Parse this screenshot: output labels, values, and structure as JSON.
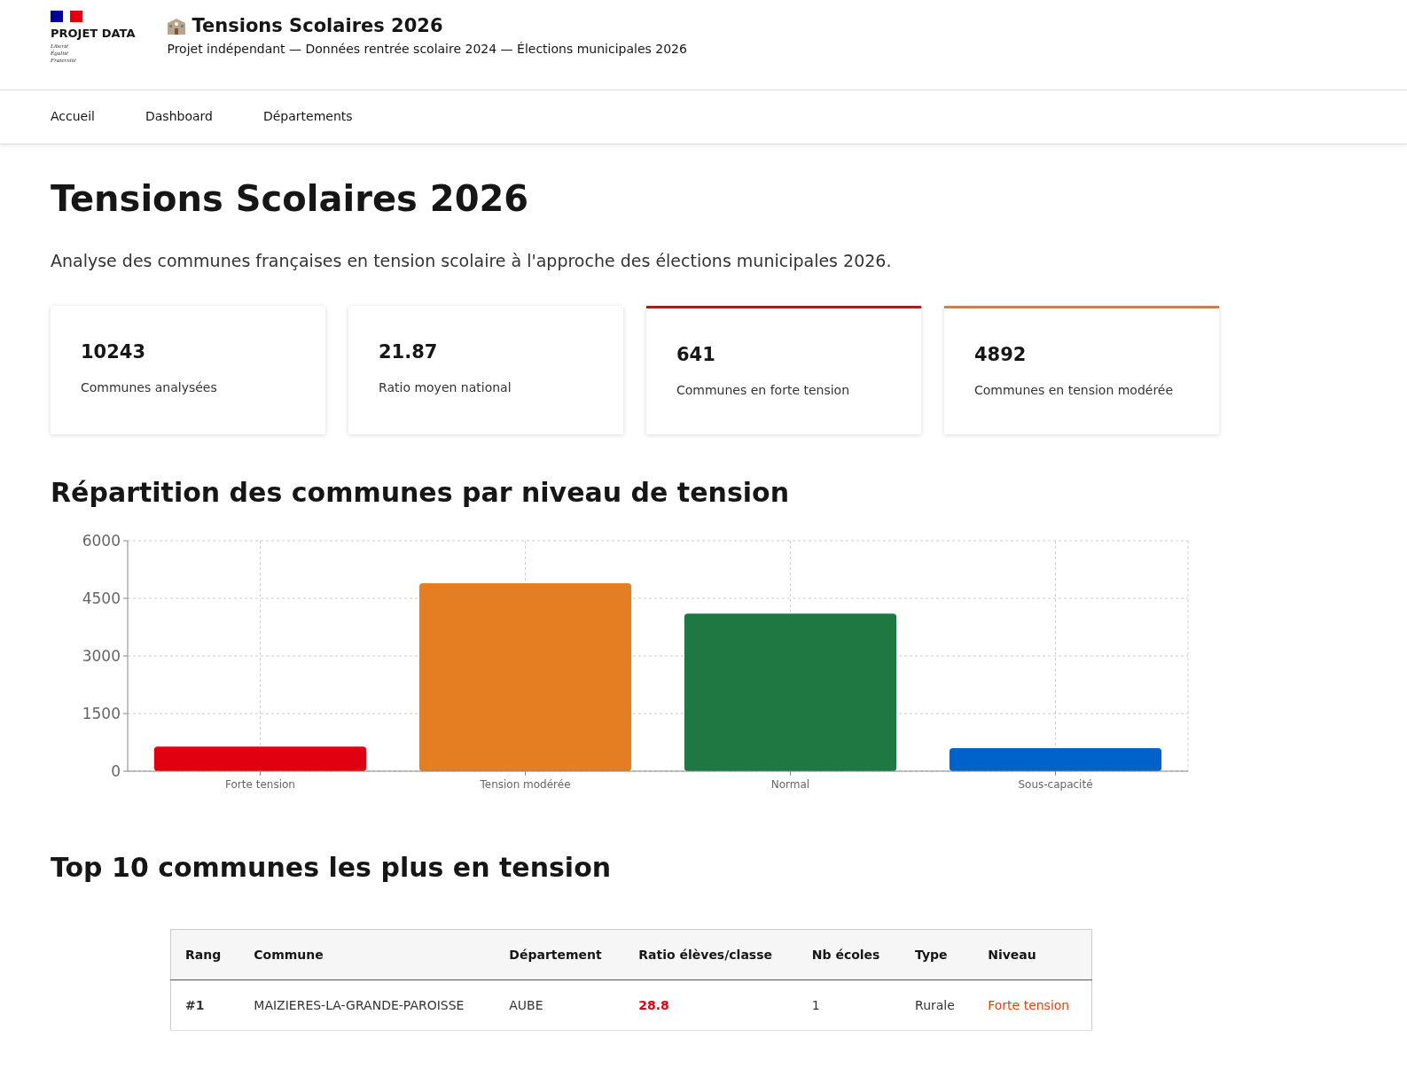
{
  "header": {
    "brand": "PROJET DATA",
    "motto": [
      "Liberté",
      "Égalité",
      "Fraternité"
    ],
    "title": "Tensions Scolaires 2026",
    "subtitle": "Projet indépendant — Données rentrée scolaire 2024 — Élections municipales 2026"
  },
  "nav": [
    {
      "label": "Accueil",
      "selected": false
    },
    {
      "label": "Dashboard",
      "selected": false
    },
    {
      "label": "Départements",
      "selected": false
    }
  ],
  "page_title": "Tensions Scolaires 2026",
  "intro": "Analyse des communes françaises en tension scolaire à l'approche des élections municipales 2026.",
  "stats": [
    {
      "value": "10243",
      "label": "Communes analysées"
    },
    {
      "value": "21.87",
      "label": "Ratio moyen national"
    },
    {
      "value": "641",
      "label": "Communes en forte tension",
      "color": "#e1000f"
    },
    {
      "value": "4892",
      "label": "Communes en tension modérée",
      "color": "#e4792b"
    }
  ],
  "chart_section": {
    "title": "Répartition des communes par niveau de tension",
    "chart_data": {
      "type": "bar",
      "categories": [
        "Forte tension",
        "Tension modérée",
        "Normal",
        "Sous-capacité"
      ],
      "colors": [
        "#e1000f",
        "#e37e22",
        "#1e7841",
        "#0063cb"
      ],
      "series": [
        {
          "values": [
            641,
            4892,
            4100,
            600
          ]
        }
      ],
      "grid": true,
      "ylim": [
        0,
        6000
      ],
      "yticks": [
        0,
        1500,
        3000,
        4500,
        6000
      ]
    }
  },
  "table_section": {
    "title": "Top 10 communes les plus en tension",
    "columns": [
      "Rang",
      "Commune",
      "Département",
      "Ratio élèves/classe",
      "Nb écoles",
      "Type",
      "Niveau"
    ],
    "rows": [
      [
        "#1",
        "MAIZIERES-LA-GRANDE-PAROISSE",
        "AUBE",
        "28.8",
        "1",
        "Rurale",
        "Forte tension"
      ]
    ]
  }
}
